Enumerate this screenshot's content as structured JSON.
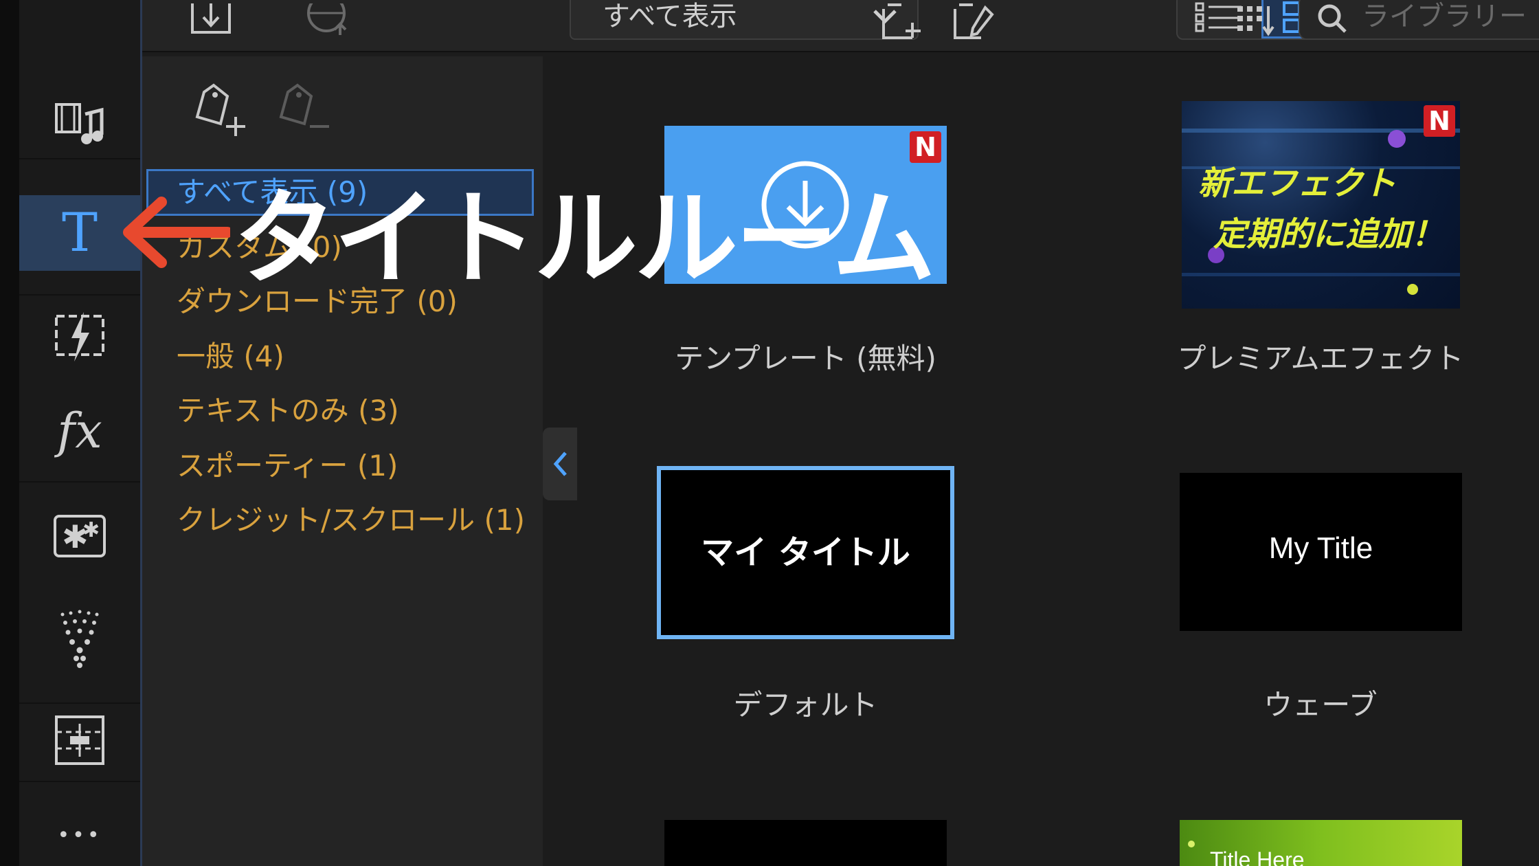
{
  "toolbar": {
    "filter_value": "すべて表示",
    "search_placeholder": "ライブラリー"
  },
  "sidebar": {
    "items": [
      {
        "icon": "media-music-icon"
      },
      {
        "icon": "title-room-icon",
        "label": "T",
        "active": true
      },
      {
        "icon": "transition-icon"
      },
      {
        "icon": "effects-fx-icon",
        "label": "fx"
      },
      {
        "icon": "particle-icon"
      },
      {
        "icon": "spray-icon"
      },
      {
        "icon": "subtitle-icon"
      },
      {
        "icon": "more-icon",
        "label": "•••"
      }
    ]
  },
  "tags": [
    {
      "label": "すべて表示 (9)",
      "selected": true
    },
    {
      "label": "カスタム (0)"
    },
    {
      "label": "ダウンロード完了 (0)"
    },
    {
      "label": "一般 (4)"
    },
    {
      "label": "テキストのみ (3)"
    },
    {
      "label": "スポーティー (1)"
    },
    {
      "label": "クレジット/スクロール (1)"
    }
  ],
  "grid": {
    "items": [
      {
        "caption": "テンプレート (無料)",
        "badge": "N"
      },
      {
        "caption": "プレミアムエフェクト",
        "badge": "N",
        "thumb_text": [
          "新エフェクト",
          "定期的に追加！"
        ]
      },
      {
        "caption": "デフォルト",
        "thumb_text": "マイ タイトル",
        "selected": true
      },
      {
        "caption": "ウェーブ",
        "thumb_text": "My Title"
      },
      {
        "caption": ""
      },
      {
        "caption": "",
        "thumb_text": "Title Here"
      }
    ]
  },
  "overlay": {
    "text": "タイトルルーム"
  },
  "colors": {
    "accent": "#3b78c6",
    "tag_text": "#d9a23e",
    "badge": "#d11f24",
    "arrow": "#e8492e",
    "template_bg": "#4a9ff0"
  }
}
